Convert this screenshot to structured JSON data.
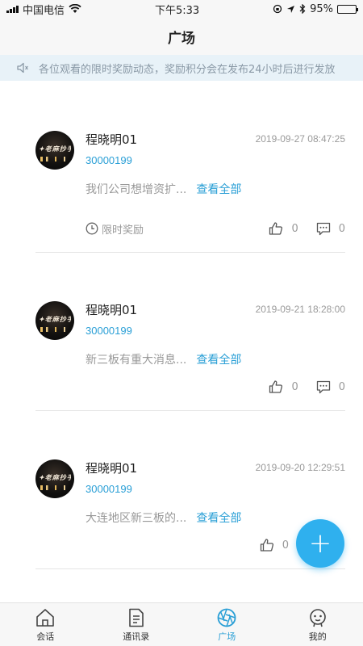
{
  "status": {
    "carrier": "中国电信",
    "time": "下午5:33",
    "battery": "95%",
    "battery_level": 0.95
  },
  "nav": {
    "title": "广场"
  },
  "notice": {
    "text": "各位观看的限时奖励动态，奖励积分会在发布24小时后进行发放"
  },
  "posts": [
    {
      "name": "程晓明01",
      "time": "2019-09-27 08:47:25",
      "uid": "30000199",
      "excerpt": "我们公司想增资扩...",
      "more": "查看全部",
      "reward": "限时奖励",
      "likes": "0",
      "comments": "0"
    },
    {
      "name": "程晓明01",
      "time": "2019-09-21 18:28:00",
      "uid": "30000199",
      "excerpt": "新三板有重大消息...",
      "more": "查看全部",
      "likes": "0",
      "comments": "0"
    },
    {
      "name": "程晓明01",
      "time": "2019-09-20 12:29:51",
      "uid": "30000199",
      "excerpt": "大连地区新三板的...",
      "more": "查看全部",
      "likes": "0"
    }
  ],
  "fab": {
    "label": "+"
  },
  "tabs": [
    {
      "label": "会话",
      "icon": "home-icon"
    },
    {
      "label": "通讯录",
      "icon": "document-icon"
    },
    {
      "label": "广场",
      "icon": "aperture-icon",
      "active": true
    },
    {
      "label": "我的",
      "icon": "robot-face-icon"
    }
  ],
  "colors": {
    "accent": "#2a9fd6",
    "fab": "#2fb0ee",
    "notice_bg": "#e8f2f8"
  }
}
